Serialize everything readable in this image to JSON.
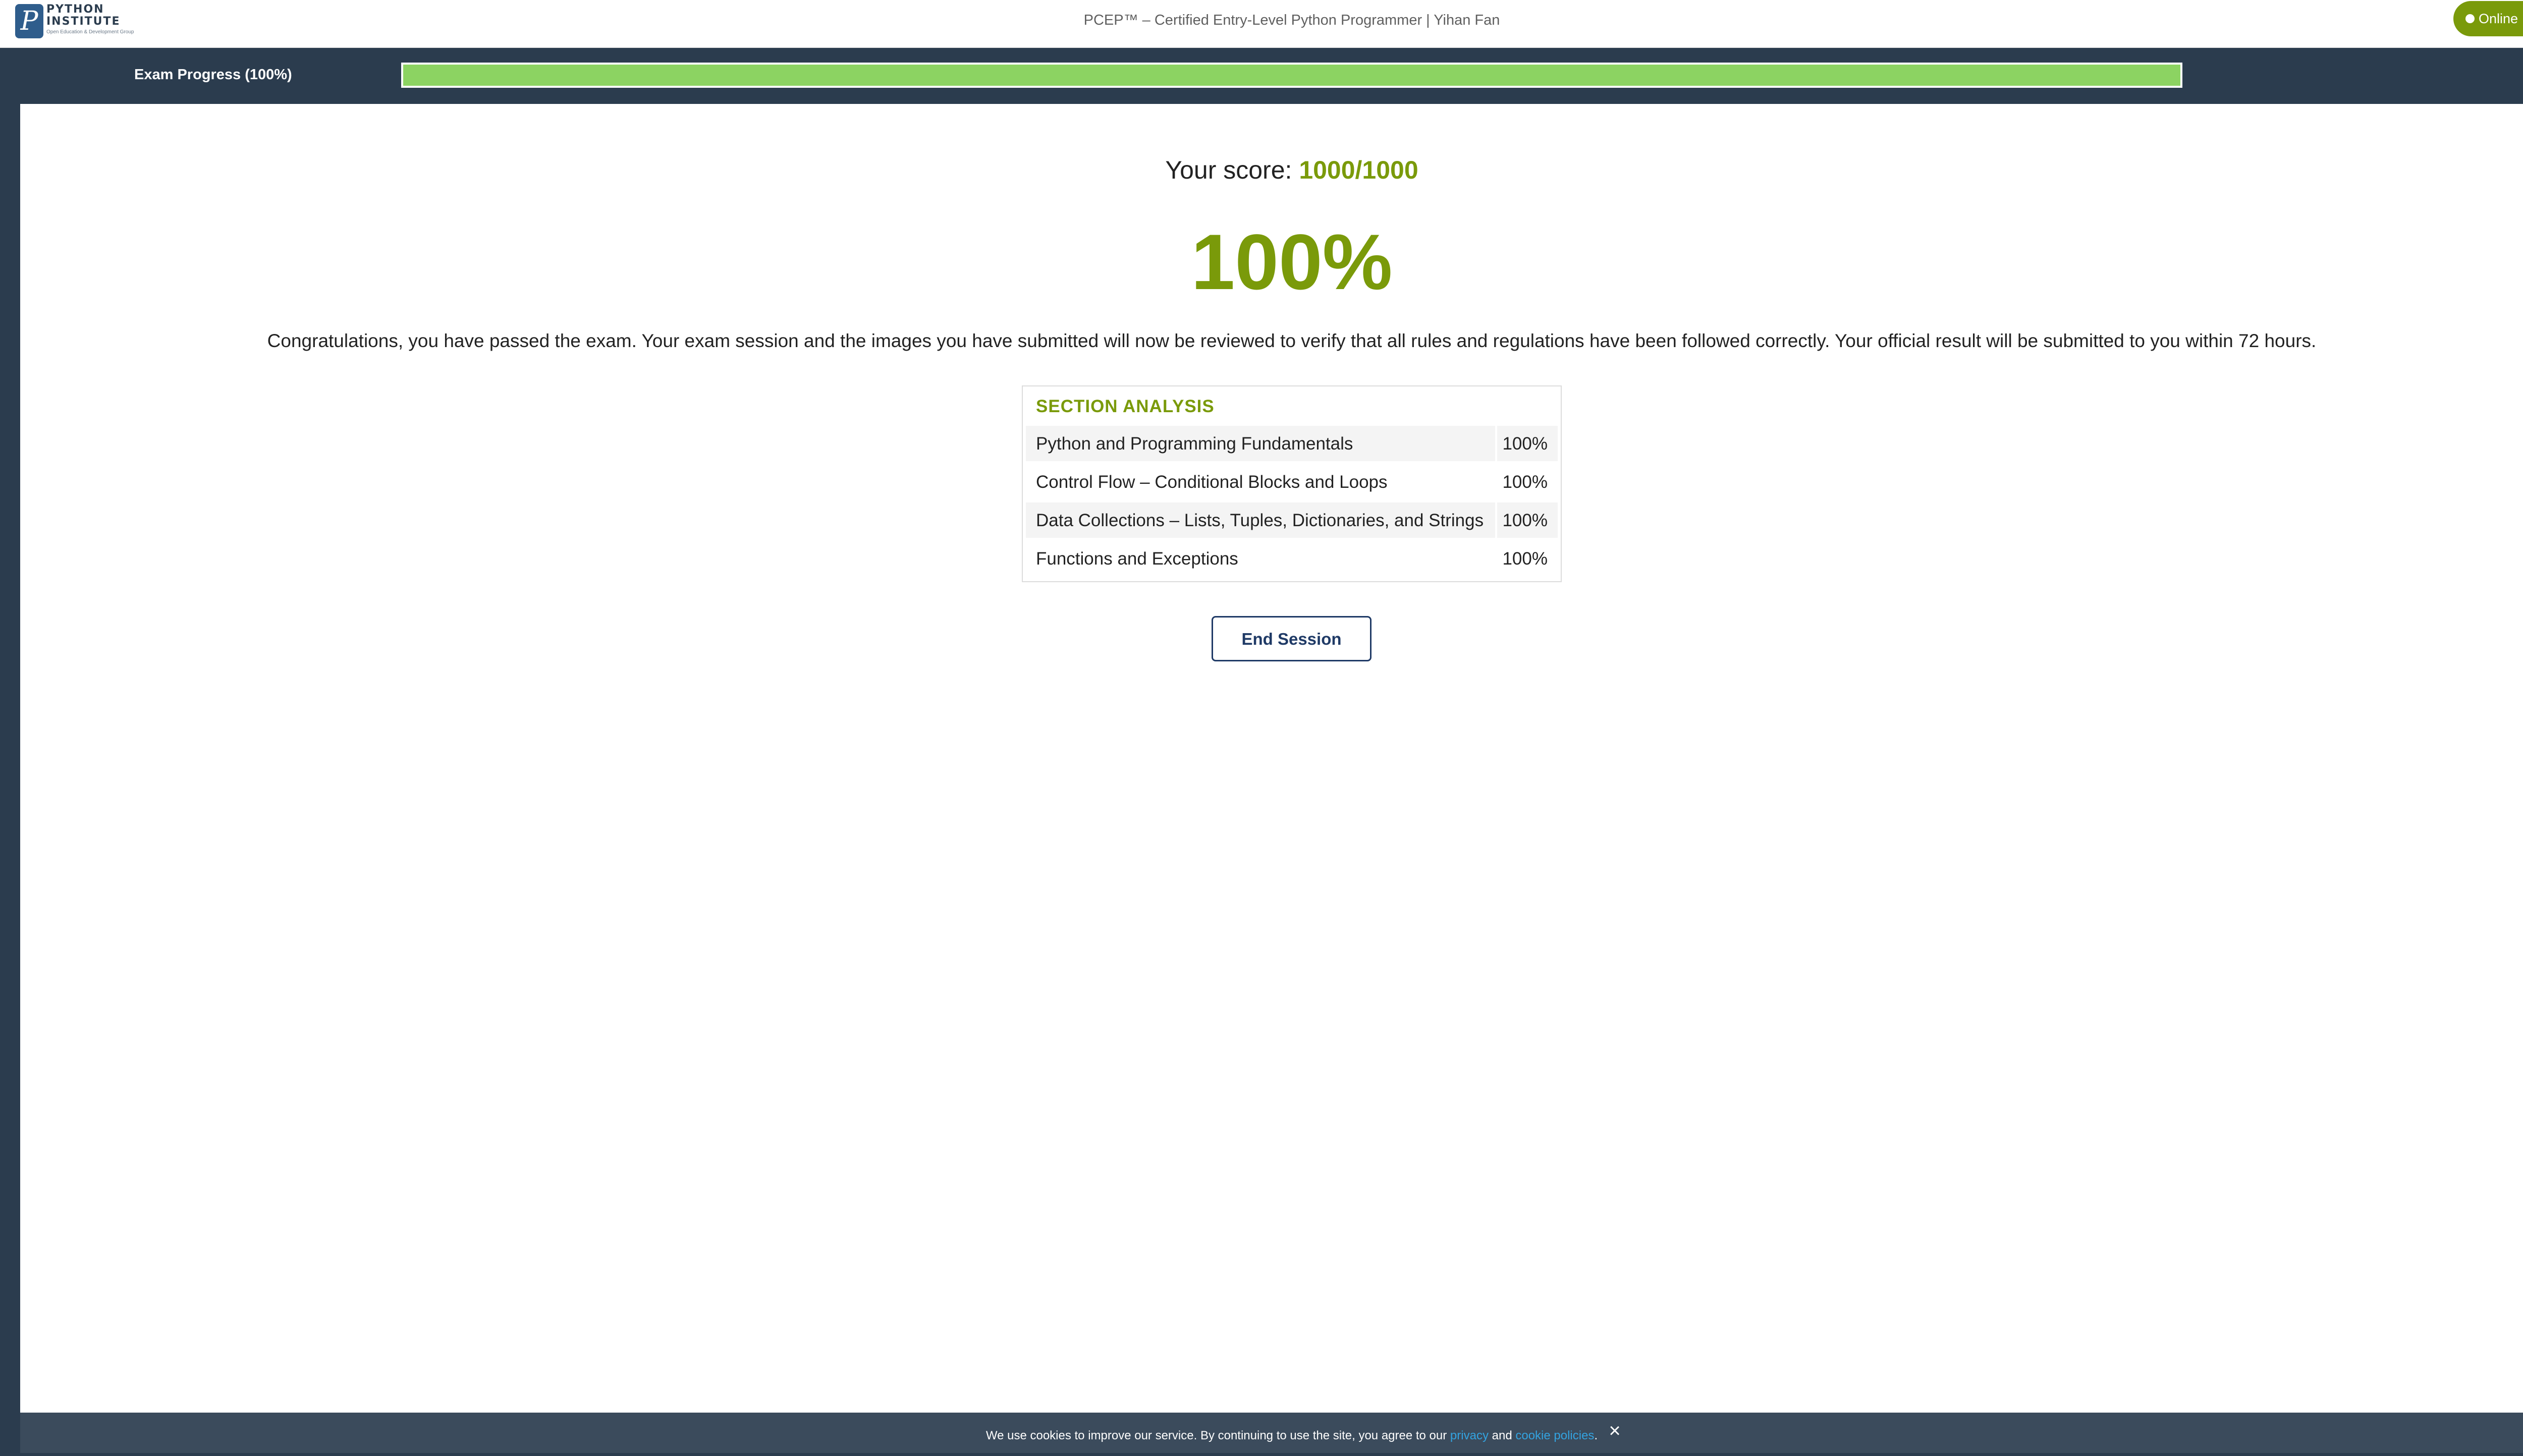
{
  "logo": {
    "line1": "PYTHON",
    "line2": "INSTITUTE",
    "line3": "Open Education & Development Group",
    "mark": "P"
  },
  "header": {
    "title": "PCEP™ – Certified Entry-Level Python Programmer | Yihan Fan",
    "status_label": "Online"
  },
  "progress": {
    "label": "Exam Progress (100%)",
    "value_percent": 100
  },
  "result": {
    "score_label": "Your score:",
    "score_value": "1000/1000",
    "percent": "100%",
    "message": "Congratulations, you have passed the exam. Your exam session and the images you have submitted will now be reviewed to verify that all rules and regulations have been followed correctly. Your official result will be submitted to you within 72 hours."
  },
  "section_analysis": {
    "title": "SECTION ANALYSIS",
    "rows": [
      {
        "name": "Python and Programming Fundamentals",
        "value": "100%"
      },
      {
        "name": "Control Flow – Conditional Blocks and Loops",
        "value": "100%"
      },
      {
        "name": "Data Collections – Lists, Tuples, Dictionaries, and Strings",
        "value": "100%"
      },
      {
        "name": "Functions and Exceptions",
        "value": "100%"
      }
    ]
  },
  "actions": {
    "end_session_label": "End Session"
  },
  "cookie": {
    "text_before": "We use cookies to improve our service. By continuing to use the site, you agree to our ",
    "privacy_link": "privacy",
    "and": " and ",
    "cookie_link": "cookie policies",
    "text_after": ".",
    "close_icon": "×"
  },
  "colors": {
    "accent_green": "#7a9a0a",
    "progress_green": "#8cd362",
    "page_background": "#2b3c4e",
    "button_navy": "#1f3a66",
    "link_blue": "#33a3e0"
  }
}
